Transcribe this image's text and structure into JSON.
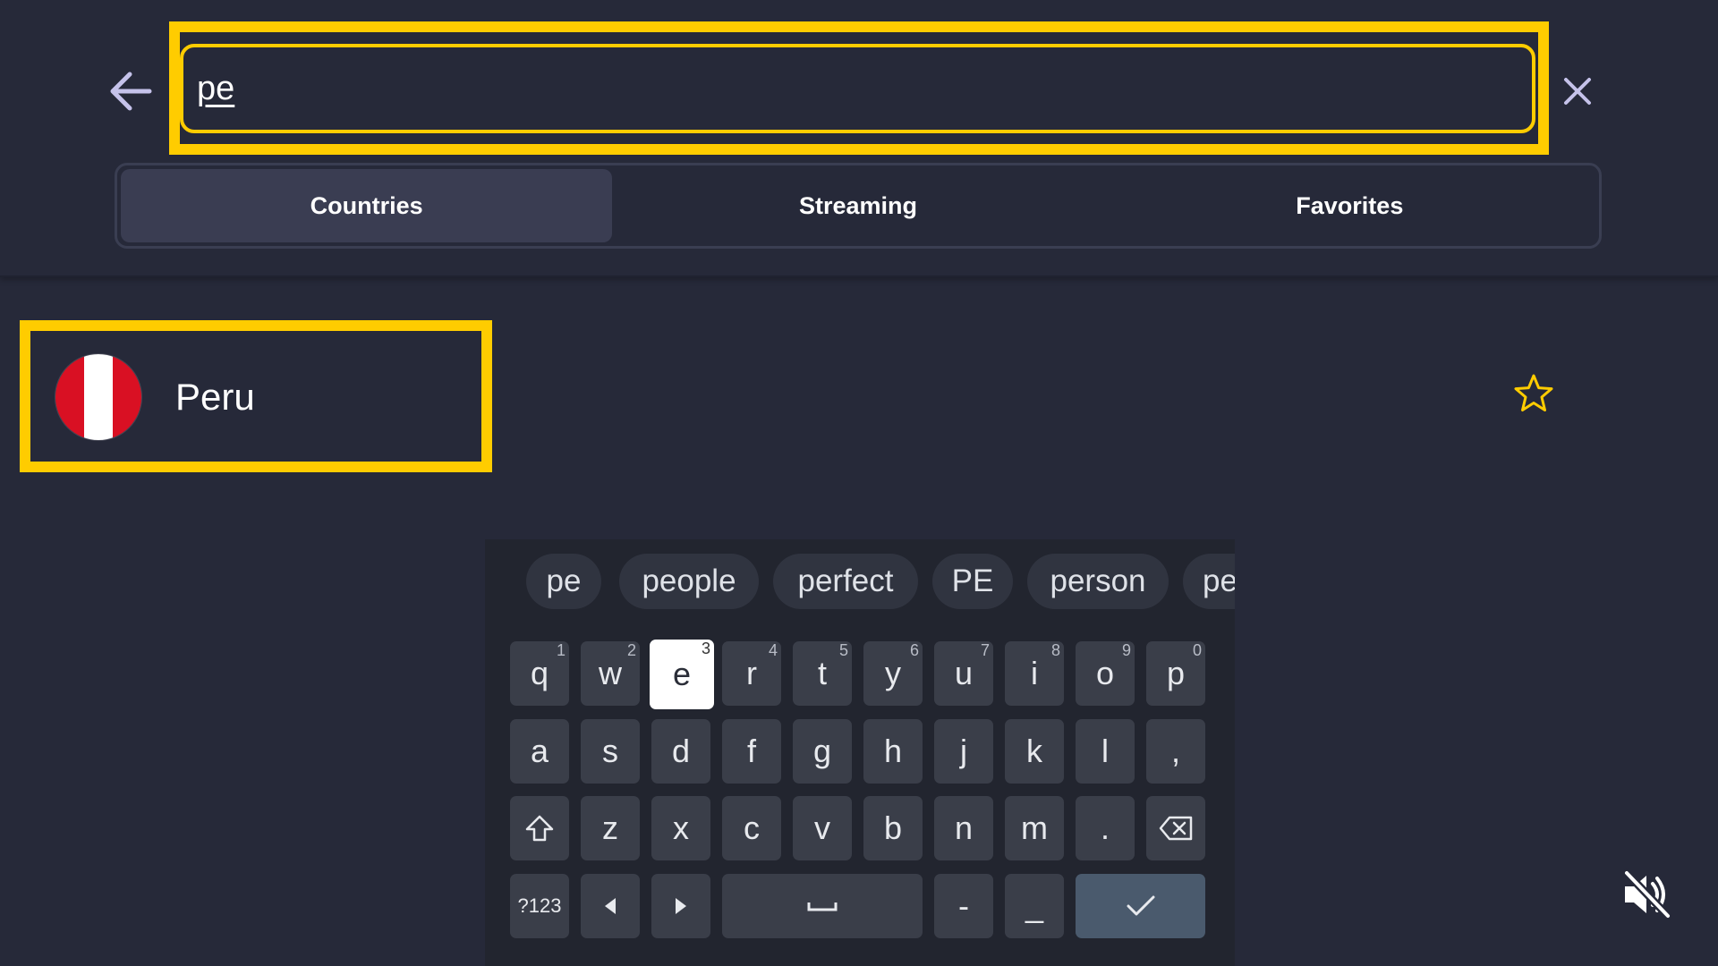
{
  "search": {
    "value": "pe",
    "placeholder": ""
  },
  "tabs": [
    {
      "label": "Countries",
      "active": true
    },
    {
      "label": "Streaming",
      "active": false
    },
    {
      "label": "Favorites",
      "active": false
    }
  ],
  "results": [
    {
      "name": "Peru",
      "flag": "peru-flag",
      "favorite": false
    }
  ],
  "colors": {
    "focus": "#ffcc00",
    "background": "#262939",
    "star": "#ffcc00"
  },
  "keyboard": {
    "suggestions": [
      "pe",
      "people",
      "perfect",
      "PE",
      "person",
      "pe"
    ],
    "row1": [
      {
        "k": "q",
        "h": "1"
      },
      {
        "k": "w",
        "h": "2"
      },
      {
        "k": "e",
        "h": "3"
      },
      {
        "k": "r",
        "h": "4"
      },
      {
        "k": "t",
        "h": "5"
      },
      {
        "k": "y",
        "h": "6"
      },
      {
        "k": "u",
        "h": "7"
      },
      {
        "k": "i",
        "h": "8"
      },
      {
        "k": "o",
        "h": "9"
      },
      {
        "k": "p",
        "h": "0"
      }
    ],
    "row2": [
      "a",
      "s",
      "d",
      "f",
      "g",
      "h",
      "j",
      "k",
      "l",
      ","
    ],
    "row3": [
      "z",
      "x",
      "c",
      "v",
      "b",
      "n",
      "m",
      "."
    ],
    "symbols_label": "?123",
    "dash": "-",
    "underscore": "_",
    "focused_key": "e"
  },
  "icons": {
    "back": "arrow-left-icon",
    "clear": "close-icon",
    "star": "star-outline-icon",
    "mute": "volume-muted-icon"
  }
}
